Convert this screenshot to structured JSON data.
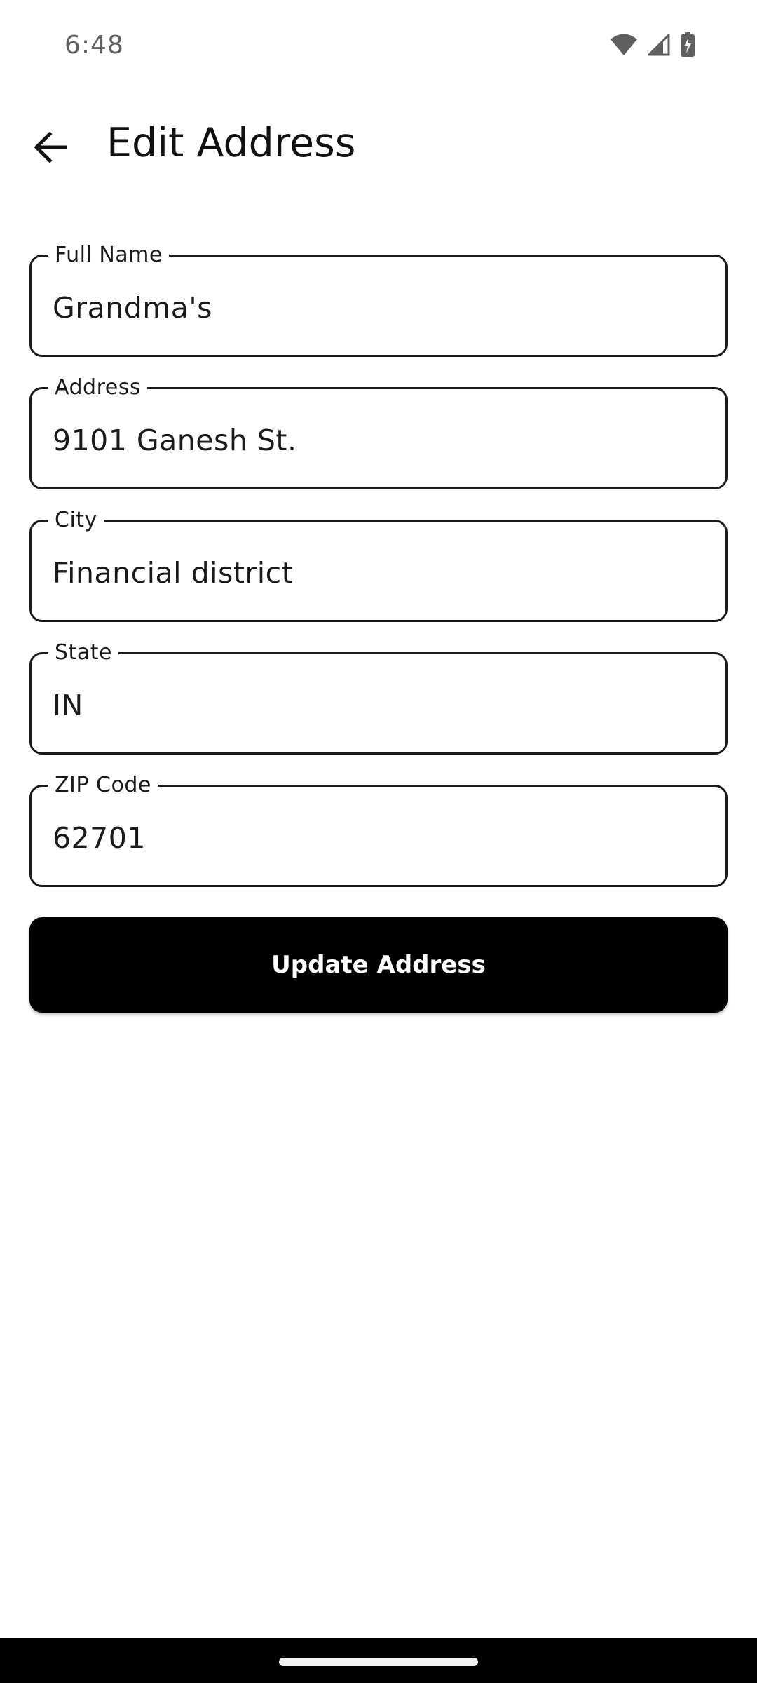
{
  "status_bar": {
    "time": "6:48",
    "icons": [
      "wifi-icon",
      "cellular-signal-icon",
      "battery-charging-icon"
    ]
  },
  "app_bar": {
    "back_icon": "arrow-back-icon",
    "title": "Edit Address"
  },
  "form": {
    "fields": [
      {
        "label": "Full Name",
        "value": "Grandma's"
      },
      {
        "label": "Address",
        "value": "9101 Ganesh St."
      },
      {
        "label": "City",
        "value": "Financial district"
      },
      {
        "label": "State",
        "value": "IN"
      },
      {
        "label": "ZIP Code",
        "value": "62701"
      }
    ],
    "submit_label": "Update Address"
  },
  "colors": {
    "background": "#ffffff",
    "button": "#000000",
    "button_text": "#ffffff",
    "border": "#1a1a1a",
    "status_text": "#5f5f5f"
  }
}
